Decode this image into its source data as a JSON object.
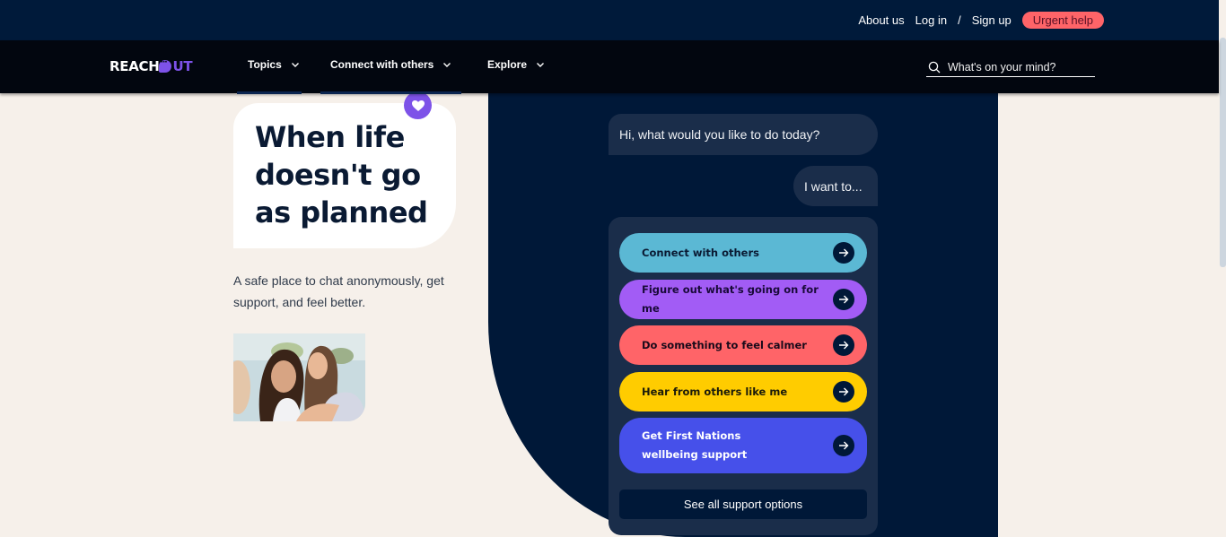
{
  "utility_bar": {
    "about_label": "About us",
    "login_label": "Log in",
    "separator": "/",
    "signup_label": "Sign up",
    "urgent_label": "Urgent help",
    "urgent_color": "#ff6468"
  },
  "nav": {
    "logo_reach": "REACH",
    "logo_out": "UT",
    "items": [
      {
        "label": "Topics"
      },
      {
        "label": "Connect with others"
      },
      {
        "label": "Explore"
      }
    ],
    "search_placeholder": "What's on your mind?"
  },
  "hero": {
    "headline": "When life doesn't go as planned",
    "tagline": "A safe place to chat anonymously, get support, and feel better."
  },
  "chat": {
    "bot_message": "Hi, what would you like to do today?",
    "user_message": "I want to...",
    "options": [
      {
        "label": "Connect with others",
        "color": "#5bb8d4",
        "text_color": "#0a1a33"
      },
      {
        "label": "Figure out what's going on for me",
        "color": "#a25cf5",
        "text_color": "#1a0a3a"
      },
      {
        "label": "Do something to feel calmer",
        "color": "#ff6468",
        "text_color": "#1a0a1a"
      },
      {
        "label": "Hear from others like me",
        "color": "#ffcc00",
        "text_color": "#1a1a0a"
      },
      {
        "label": "Get First Nations wellbeing support",
        "color": "#4650ea",
        "text_color": "#ffffff"
      }
    ],
    "see_all_label": "See all support options"
  },
  "colors": {
    "brand_purple": "#7d52e8",
    "navy": "#001838",
    "cream": "#f6f0ea"
  }
}
